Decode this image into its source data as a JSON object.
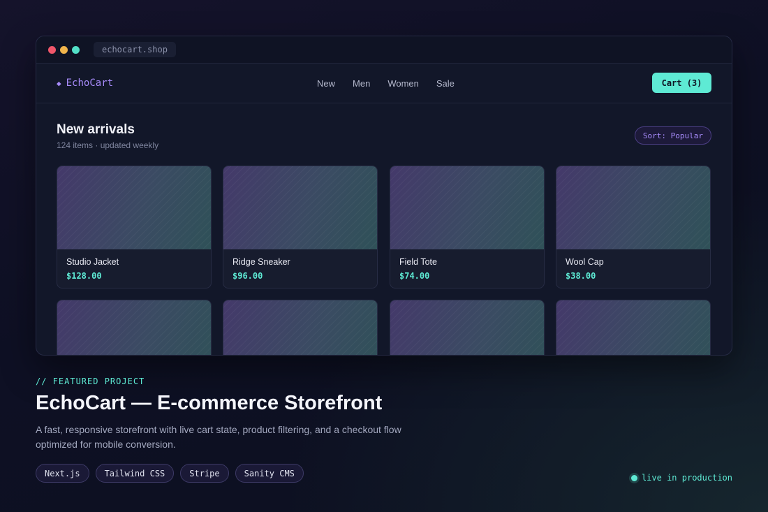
{
  "browser": {
    "url": "echocart.shop",
    "colors": {
      "close": "#f0566a",
      "minimize": "#f2b54c",
      "maximize": "#53e0c8"
    }
  },
  "store": {
    "brand": "EchoCart",
    "brand_icon": "diamond-icon",
    "nav": [
      "New",
      "Men",
      "Women",
      "Sale"
    ],
    "cart_label": "Cart (3)",
    "section_title": "New arrivals",
    "section_subtitle": "124 items · updated weekly",
    "sort_label": "Sort: Popular",
    "products": [
      {
        "name": "Studio Jacket",
        "price": "$128.00"
      },
      {
        "name": "Ridge Sneaker",
        "price": "$96.00"
      },
      {
        "name": "Field Tote",
        "price": "$74.00"
      },
      {
        "name": "Wool Cap",
        "price": "$38.00"
      }
    ]
  },
  "project": {
    "label": "// FEATURED PROJECT",
    "title": "EchoCart — E-commerce Storefront",
    "description": "A fast, responsive storefront with live cart state, product filtering, and a checkout flow optimized for mobile conversion.",
    "tags": [
      "Next.js",
      "Tailwind CSS",
      "Stripe",
      "Sanity CMS"
    ],
    "status": "live in production"
  },
  "colors": {
    "accent": "#5eead4",
    "brand": "#a78bfa"
  }
}
